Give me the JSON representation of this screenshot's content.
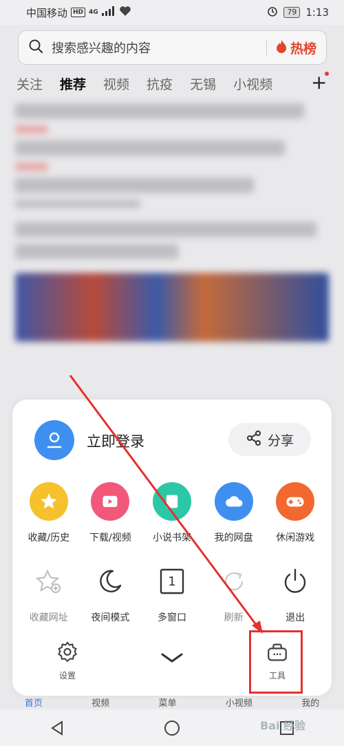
{
  "status_bar": {
    "carrier": "中国移动",
    "hd": "HD",
    "network": "4G",
    "battery": "79",
    "time": "1:13"
  },
  "search": {
    "placeholder": "搜索感兴趣的内容",
    "hot_label": "热榜"
  },
  "tabs": [
    {
      "label": "关注"
    },
    {
      "label": "推荐",
      "active": true
    },
    {
      "label": "视频"
    },
    {
      "label": "抗疫"
    },
    {
      "label": "无锡"
    },
    {
      "label": "小视频"
    }
  ],
  "sheet": {
    "login_label": "立即登录",
    "share_label": "分享",
    "row1": [
      {
        "label": "收藏/历史",
        "icon": "star-icon",
        "color": "#f6c12c"
      },
      {
        "label": "下载/视频",
        "icon": "download-video-icon",
        "color": "#f1587a"
      },
      {
        "label": "小说书架",
        "icon": "book-icon",
        "color": "#2cc7a7"
      },
      {
        "label": "我的网盘",
        "icon": "cloud-icon",
        "color": "#3e8ff0"
      },
      {
        "label": "休闲游戏",
        "icon": "gamepad-icon",
        "color": "#f2682e"
      }
    ],
    "row2": [
      {
        "label": "收藏网址",
        "icon": "star-add-icon",
        "disabled": true
      },
      {
        "label": "夜间模式",
        "icon": "moon-icon"
      },
      {
        "label": "多窗口",
        "icon": "window-count-icon",
        "count": "1"
      },
      {
        "label": "刷新",
        "icon": "refresh-icon",
        "disabled": true
      },
      {
        "label": "退出",
        "icon": "power-icon"
      }
    ],
    "footer": {
      "settings_label": "设置",
      "tools_label": "工具"
    }
  },
  "bottom_nav": [
    {
      "label": "首页",
      "active": true
    },
    {
      "label": "视频"
    },
    {
      "label": "菜单"
    },
    {
      "label": "小视频"
    },
    {
      "label": "我的"
    }
  ],
  "watermark": "Bai 经验",
  "colors": {
    "accent_blue": "#3e8ff0",
    "annotation_red": "#e53030",
    "hot_red": "#e3452e"
  }
}
